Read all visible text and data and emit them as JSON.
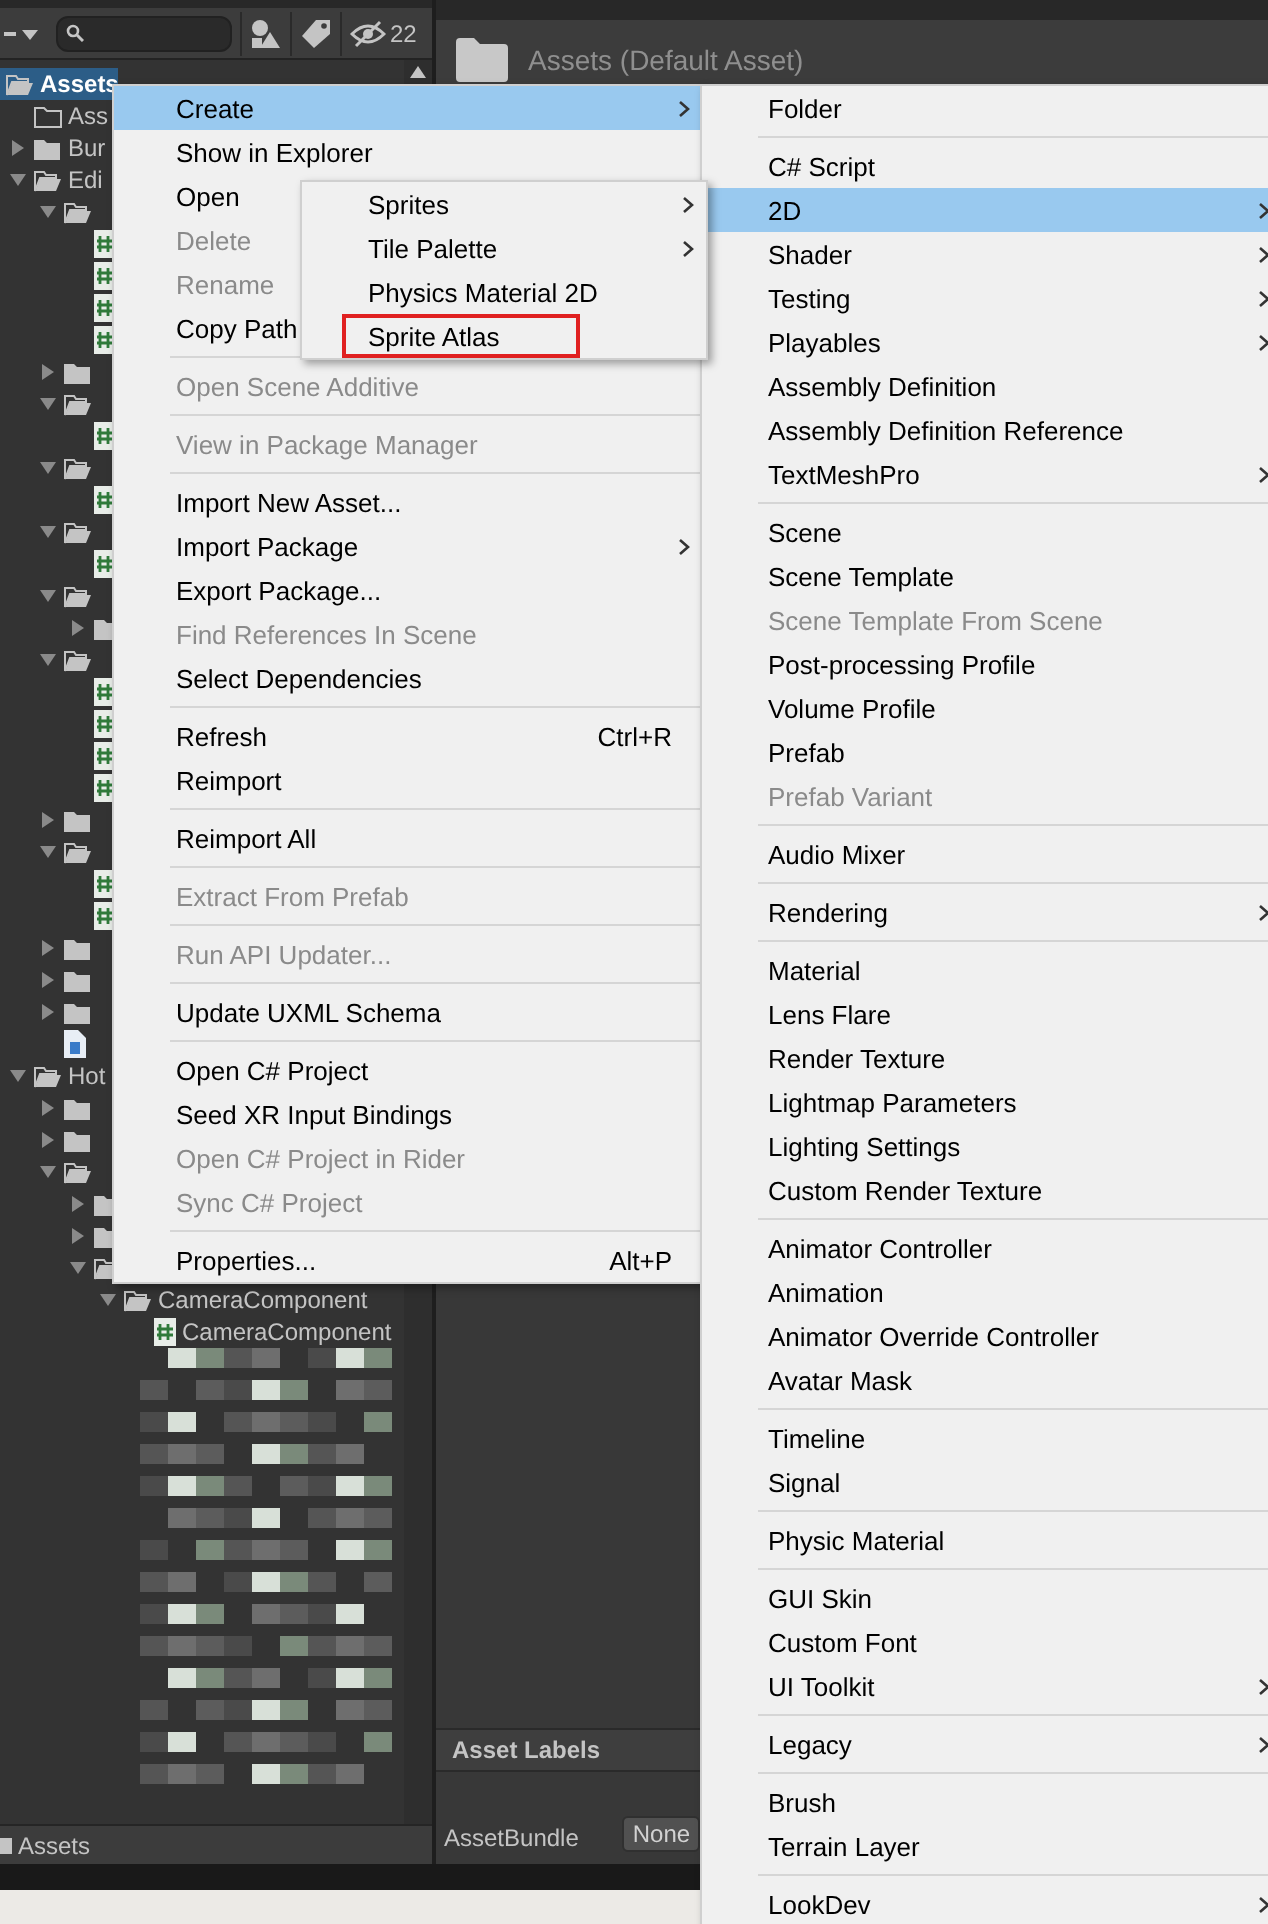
{
  "project_panel": {
    "toolbar": {
      "hidden_count": "22"
    },
    "tree": [
      {
        "label": "Assets",
        "kind": "folder",
        "expanded": true,
        "selected": true,
        "children": [
          {
            "label": "Ass",
            "kind": "folder-empty",
            "selected": false
          },
          {
            "label": "Bur",
            "kind": "folder",
            "expanded": false,
            "selected": false
          },
          {
            "label": "Edi",
            "kind": "folder",
            "expanded": true,
            "selected": false,
            "children": [
              {
                "kind": "folder",
                "expanded": true,
                "selected": false,
                "children": [
                  {
                    "kind": "script",
                    "selected": false
                  },
                  {
                    "kind": "script",
                    "selected": false
                  },
                  {
                    "kind": "script",
                    "selected": false
                  },
                  {
                    "kind": "script",
                    "selected": false
                  }
                ]
              },
              {
                "kind": "folder",
                "expanded": false,
                "selected": false
              },
              {
                "kind": "folder",
                "expanded": true,
                "selected": false,
                "children": [
                  {
                    "kind": "script",
                    "selected": false
                  }
                ]
              },
              {
                "kind": "folder",
                "expanded": true,
                "selected": false,
                "children": [
                  {
                    "kind": "script",
                    "selected": false
                  }
                ]
              },
              {
                "kind": "folder",
                "expanded": true,
                "selected": false,
                "children": [
                  {
                    "kind": "script",
                    "selected": false
                  }
                ]
              },
              {
                "kind": "folder",
                "expanded": true,
                "selected": false,
                "children": [
                  {
                    "kind": "folder",
                    "expanded": false,
                    "selected": false
                  }
                ]
              },
              {
                "kind": "folder",
                "expanded": true,
                "selected": false,
                "children": [
                  {
                    "kind": "script",
                    "selected": false
                  },
                  {
                    "kind": "script",
                    "selected": false
                  },
                  {
                    "kind": "script",
                    "selected": false
                  },
                  {
                    "kind": "script",
                    "selected": false
                  }
                ]
              },
              {
                "kind": "folder",
                "expanded": false,
                "selected": false
              },
              {
                "kind": "folder",
                "expanded": true,
                "selected": false,
                "children": [
                  {
                    "kind": "script",
                    "selected": false
                  },
                  {
                    "kind": "script",
                    "selected": false
                  }
                ]
              },
              {
                "kind": "folder",
                "expanded": false,
                "selected": false
              },
              {
                "kind": "folder",
                "expanded": false,
                "selected": false
              },
              {
                "kind": "folder",
                "expanded": false,
                "selected": false
              },
              {
                "kind": "file",
                "selected": false
              }
            ]
          },
          {
            "label": "Hot",
            "kind": "folder",
            "expanded": true,
            "selected": false,
            "children": [
              {
                "kind": "folder",
                "expanded": false,
                "selected": false
              },
              {
                "kind": "folder",
                "expanded": false,
                "selected": false
              },
              {
                "kind": "folder",
                "expanded": true,
                "selected": false,
                "children": [
                  {
                    "kind": "folder",
                    "expanded": false,
                    "selected": false
                  },
                  {
                    "kind": "folder",
                    "expanded": false,
                    "selected": false
                  },
                  {
                    "kind": "folder",
                    "expanded": true,
                    "selected": false,
                    "children": [
                      {
                        "label": "CameraComponent",
                        "kind": "folder",
                        "expanded": true,
                        "selected": false,
                        "children": [
                          {
                            "label": "CameraComponent",
                            "kind": "script",
                            "selected": false
                          }
                        ]
                      }
                    ]
                  }
                ]
              }
            ]
          }
        ]
      }
    ],
    "path": "Assets"
  },
  "inspector": {
    "title": "Assets (Default Asset)",
    "asset_labels": "Asset Labels",
    "asset_bundle": {
      "label": "AssetBundle",
      "value": "None"
    }
  },
  "context_menu": {
    "items": [
      {
        "kind": "item",
        "label": "Create",
        "selected": true,
        "disabled": false,
        "submenu": true
      },
      {
        "kind": "item",
        "label": "Show in Explorer",
        "selected": false,
        "disabled": false
      },
      {
        "kind": "item",
        "label": "Open",
        "selected": false,
        "disabled": false
      },
      {
        "kind": "item",
        "label": "Delete",
        "selected": false,
        "disabled": true
      },
      {
        "kind": "item",
        "label": "Rename",
        "selected": false,
        "disabled": true
      },
      {
        "kind": "item",
        "label": "Copy Path",
        "selected": false,
        "disabled": false
      },
      {
        "kind": "separator"
      },
      {
        "kind": "item",
        "label": "Open Scene Additive",
        "selected": false,
        "disabled": true
      },
      {
        "kind": "separator"
      },
      {
        "kind": "item",
        "label": "View in Package Manager",
        "selected": false,
        "disabled": true
      },
      {
        "kind": "separator"
      },
      {
        "kind": "item",
        "label": "Import New Asset...",
        "selected": false,
        "disabled": false
      },
      {
        "kind": "item",
        "label": "Import Package",
        "selected": false,
        "disabled": false,
        "submenu": true
      },
      {
        "kind": "item",
        "label": "Export Package...",
        "selected": false,
        "disabled": false
      },
      {
        "kind": "item",
        "label": "Find References In Scene",
        "selected": false,
        "disabled": true
      },
      {
        "kind": "item",
        "label": "Select Dependencies",
        "selected": false,
        "disabled": false
      },
      {
        "kind": "separator"
      },
      {
        "kind": "item",
        "label": "Refresh",
        "selected": false,
        "disabled": false,
        "shortcut": "Ctrl+R"
      },
      {
        "kind": "item",
        "label": "Reimport",
        "selected": false,
        "disabled": false
      },
      {
        "kind": "separator"
      },
      {
        "kind": "item",
        "label": "Reimport All",
        "selected": false,
        "disabled": false
      },
      {
        "kind": "separator"
      },
      {
        "kind": "item",
        "label": "Extract From Prefab",
        "selected": false,
        "disabled": true
      },
      {
        "kind": "separator"
      },
      {
        "kind": "item",
        "label": "Run API Updater...",
        "selected": false,
        "disabled": true
      },
      {
        "kind": "separator"
      },
      {
        "kind": "item",
        "label": "Update UXML Schema",
        "selected": false,
        "disabled": false
      },
      {
        "kind": "separator"
      },
      {
        "kind": "item",
        "label": "Open C# Project",
        "selected": false,
        "disabled": false
      },
      {
        "kind": "item",
        "label": "Seed XR Input Bindings",
        "selected": false,
        "disabled": false
      },
      {
        "kind": "item",
        "label": "Open C# Project in Rider",
        "selected": false,
        "disabled": true
      },
      {
        "kind": "item",
        "label": "Sync C# Project",
        "selected": false,
        "disabled": true
      },
      {
        "kind": "separator"
      },
      {
        "kind": "item",
        "label": "Properties...",
        "selected": false,
        "disabled": false,
        "shortcut": "Alt+P"
      }
    ]
  },
  "create_menu": {
    "items": [
      {
        "kind": "item",
        "label": "Folder",
        "selected": false,
        "disabled": false
      },
      {
        "kind": "separator"
      },
      {
        "kind": "item",
        "label": "C# Script",
        "selected": false,
        "disabled": false
      },
      {
        "kind": "item",
        "label": "2D",
        "selected": true,
        "disabled": false,
        "submenu": true
      },
      {
        "kind": "item",
        "label": "Shader",
        "selected": false,
        "disabled": false,
        "submenu": true
      },
      {
        "kind": "item",
        "label": "Testing",
        "selected": false,
        "disabled": false,
        "submenu": true
      },
      {
        "kind": "item",
        "label": "Playables",
        "selected": false,
        "disabled": false,
        "submenu": true
      },
      {
        "kind": "item",
        "label": "Assembly Definition",
        "selected": false,
        "disabled": false
      },
      {
        "kind": "item",
        "label": "Assembly Definition Reference",
        "selected": false,
        "disabled": false
      },
      {
        "kind": "item",
        "label": "TextMeshPro",
        "selected": false,
        "disabled": false,
        "submenu": true
      },
      {
        "kind": "separator"
      },
      {
        "kind": "item",
        "label": "Scene",
        "selected": false,
        "disabled": false
      },
      {
        "kind": "item",
        "label": "Scene Template",
        "selected": false,
        "disabled": false
      },
      {
        "kind": "item",
        "label": "Scene Template From Scene",
        "selected": false,
        "disabled": true
      },
      {
        "kind": "item",
        "label": "Post-processing Profile",
        "selected": false,
        "disabled": false
      },
      {
        "kind": "item",
        "label": "Volume Profile",
        "selected": false,
        "disabled": false
      },
      {
        "kind": "item",
        "label": "Prefab",
        "selected": false,
        "disabled": false
      },
      {
        "kind": "item",
        "label": "Prefab Variant",
        "selected": false,
        "disabled": true
      },
      {
        "kind": "separator"
      },
      {
        "kind": "item",
        "label": "Audio Mixer",
        "selected": false,
        "disabled": false
      },
      {
        "kind": "separator"
      },
      {
        "kind": "item",
        "label": "Rendering",
        "selected": false,
        "disabled": false,
        "submenu": true
      },
      {
        "kind": "separator"
      },
      {
        "kind": "item",
        "label": "Material",
        "selected": false,
        "disabled": false
      },
      {
        "kind": "item",
        "label": "Lens Flare",
        "selected": false,
        "disabled": false
      },
      {
        "kind": "item",
        "label": "Render Texture",
        "selected": false,
        "disabled": false
      },
      {
        "kind": "item",
        "label": "Lightmap Parameters",
        "selected": false,
        "disabled": false
      },
      {
        "kind": "item",
        "label": "Lighting Settings",
        "selected": false,
        "disabled": false
      },
      {
        "kind": "item",
        "label": "Custom Render Texture",
        "selected": false,
        "disabled": false
      },
      {
        "kind": "separator"
      },
      {
        "kind": "item",
        "label": "Animator Controller",
        "selected": false,
        "disabled": false
      },
      {
        "kind": "item",
        "label": "Animation",
        "selected": false,
        "disabled": false
      },
      {
        "kind": "item",
        "label": "Animator Override Controller",
        "selected": false,
        "disabled": false
      },
      {
        "kind": "item",
        "label": "Avatar Mask",
        "selected": false,
        "disabled": false
      },
      {
        "kind": "separator"
      },
      {
        "kind": "item",
        "label": "Timeline",
        "selected": false,
        "disabled": false
      },
      {
        "kind": "item",
        "label": "Signal",
        "selected": false,
        "disabled": false
      },
      {
        "kind": "separator"
      },
      {
        "kind": "item",
        "label": "Physic Material",
        "selected": false,
        "disabled": false
      },
      {
        "kind": "separator"
      },
      {
        "kind": "item",
        "label": "GUI Skin",
        "selected": false,
        "disabled": false
      },
      {
        "kind": "item",
        "label": "Custom Font",
        "selected": false,
        "disabled": false
      },
      {
        "kind": "item",
        "label": "UI Toolkit",
        "selected": false,
        "disabled": false,
        "submenu": true
      },
      {
        "kind": "separator"
      },
      {
        "kind": "item",
        "label": "Legacy",
        "selected": false,
        "disabled": false,
        "submenu": true
      },
      {
        "kind": "separator"
      },
      {
        "kind": "item",
        "label": "Brush",
        "selected": false,
        "disabled": false
      },
      {
        "kind": "item",
        "label": "Terrain Layer",
        "selected": false,
        "disabled": false
      },
      {
        "kind": "separator"
      },
      {
        "kind": "item",
        "label": "LookDev",
        "selected": false,
        "disabled": false,
        "submenu": true
      }
    ]
  },
  "submenu_2d": {
    "items": [
      {
        "kind": "item",
        "label": "Sprites",
        "selected": false,
        "disabled": false,
        "submenu": true
      },
      {
        "kind": "item",
        "label": "Tile Palette",
        "selected": false,
        "disabled": false,
        "submenu": true
      },
      {
        "kind": "item",
        "label": "Physics Material 2D",
        "selected": false,
        "disabled": false
      },
      {
        "kind": "item",
        "label": "Sprite Atlas",
        "selected": false,
        "disabled": false,
        "outlined": true
      }
    ]
  }
}
